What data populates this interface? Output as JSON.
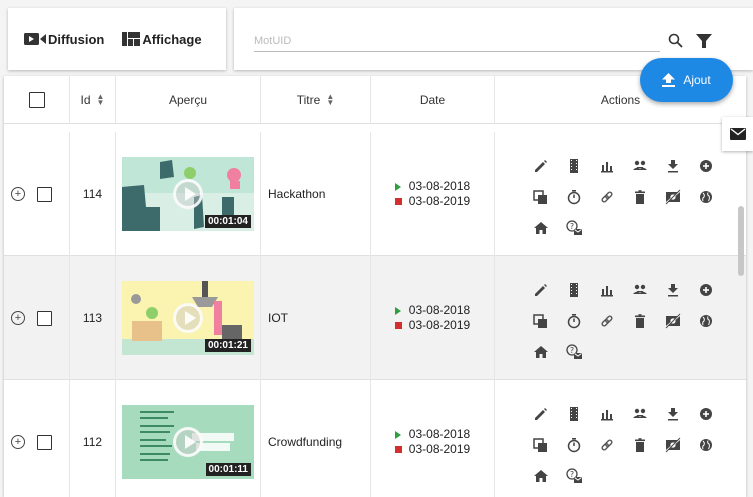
{
  "toolbar": {
    "diffusion_label": "Diffusion",
    "affichage_label": "Affichage",
    "search_placeholder": "MotUID",
    "search_value": ""
  },
  "fab": {
    "label": "Ajout"
  },
  "table": {
    "headers": {
      "id": "Id",
      "apercu": "Aperçu",
      "titre": "Titre",
      "date": "Date",
      "actions": "Actions"
    },
    "rows": [
      {
        "id": "114",
        "title": "Hackathon",
        "duration": "00:01:04",
        "start": "03-08-2018",
        "end": "03-08-2019",
        "thumb_color": "#bfe6d6"
      },
      {
        "id": "113",
        "title": "IOT",
        "duration": "00:01:21",
        "start": "03-08-2018",
        "end": "03-08-2019",
        "thumb_color": "#fbf3b0"
      },
      {
        "id": "112",
        "title": "Crowdfunding",
        "duration": "00:01:11",
        "start": "03-08-2018",
        "end": "03-08-2019",
        "thumb_color": "#a6dcbd"
      }
    ]
  },
  "colors": {
    "accent": "#1e88e5",
    "start_marker": "#2e9e3e",
    "end_marker": "#d32f2f"
  },
  "icons": {
    "actions_row1": [
      "edit-icon",
      "film-icon",
      "chart-icon",
      "share-users-icon",
      "download-icon",
      "add-circle-icon"
    ],
    "actions_row2": [
      "copy-icon",
      "timer-icon",
      "link-icon",
      "delete-icon",
      "no-preview-icon",
      "globe-icon"
    ],
    "actions_row3": [
      "home-icon",
      "mail-help-icon"
    ]
  }
}
